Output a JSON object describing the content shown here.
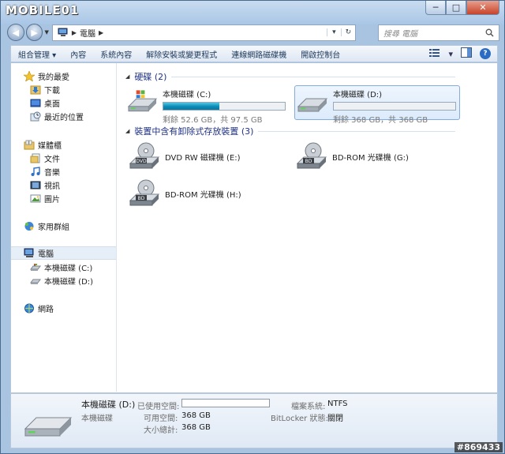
{
  "watermark": "MOBILE01",
  "window_buttons": {
    "minimize": "─",
    "maximize": "□",
    "close": "✕"
  },
  "address": {
    "crumb": "電腦",
    "refresh": "↻",
    "dropdown": "▾"
  },
  "search": {
    "placeholder": "搜尋 電腦"
  },
  "toolbar": {
    "items": [
      "組合管理 ▾",
      "內容",
      "系統內容",
      "解除安裝或變更程式",
      "連線網路磁碟機",
      "開啟控制台"
    ],
    "help": "?"
  },
  "nav": {
    "favorites": {
      "label": "我的最愛",
      "items": [
        "下載",
        "桌面",
        "最近的位置"
      ]
    },
    "libraries": {
      "label": "媒體櫃",
      "items": [
        "文件",
        "音樂",
        "視訊",
        "圖片"
      ]
    },
    "homegroup": "家用群組",
    "computer": {
      "label": "電腦",
      "items": [
        "本機磁碟 (C:)",
        "本機磁碟 (D:)"
      ]
    },
    "network": "網路"
  },
  "groups": {
    "hdd": {
      "title": "硬碟 (2)"
    },
    "removable": {
      "title": "裝置中含有卸除式存放裝置 (3)"
    }
  },
  "drives": {
    "c": {
      "name": "本機磁碟 (C:)",
      "free_text": "剩餘 52.6 GB，共 97.5 GB",
      "used_fraction": 0.46
    },
    "d": {
      "name": "本機磁碟 (D:)",
      "free_text": "剩餘 368 GB，共 368 GB",
      "used_fraction": 0.0
    },
    "e": {
      "name": "DVD RW 磁碟機 (E:)",
      "badge": "DVD"
    },
    "g": {
      "name": "BD-ROM 光碟機 (G:)",
      "badge": "BD"
    },
    "h": {
      "name": "BD-ROM 光碟機 (H:)",
      "badge": "BD"
    }
  },
  "details": {
    "title": "本機磁碟 (D:)",
    "type": "本機磁碟",
    "used_label": "已使用空間:",
    "free_label": "可用空間:",
    "free_value": "368 GB",
    "total_label": "大小總計:",
    "total_value": "368 GB",
    "fs_label": "檔案系統:",
    "fs_value": "NTFS",
    "bitlocker_label": "BitLocker 狀態:",
    "bitlocker_value": "關閉"
  },
  "credit": "#869433",
  "colors": {
    "accent": "#1e3287",
    "bar_fill": "#0a8bb5",
    "selection": "#dcebfc"
  }
}
